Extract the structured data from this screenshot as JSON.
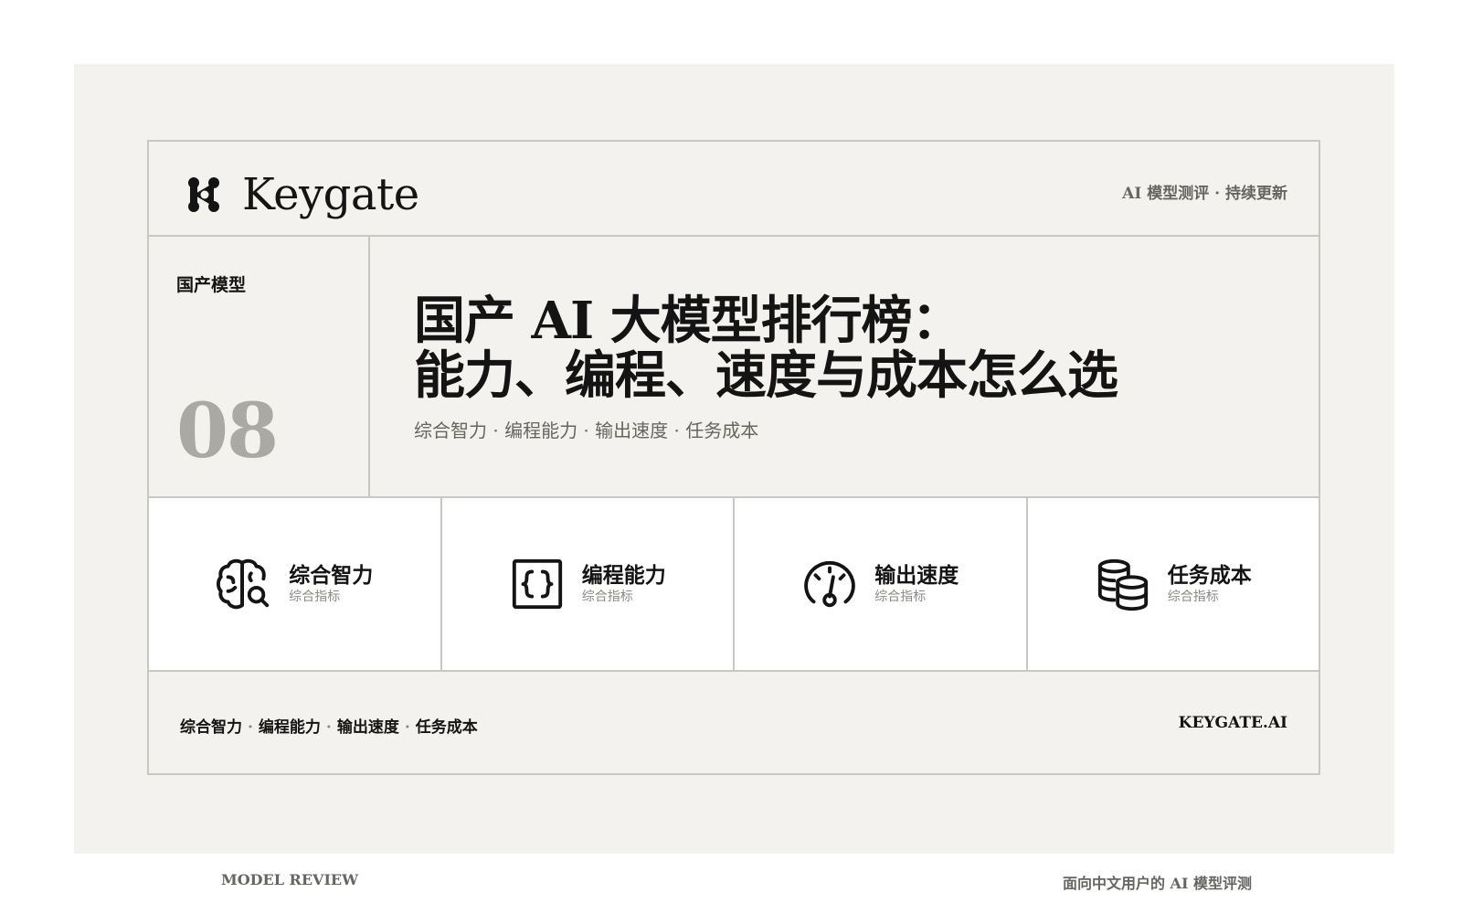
{
  "brand": {
    "name": "Keygate",
    "tagline": "AI 模型测评 · 持续更新"
  },
  "hero": {
    "category": "国产模型",
    "issue_number": "08",
    "title_line1": "国产 AI 大模型排行榜：",
    "title_line2": "能力、编程、速度与成本怎么选",
    "subtitle": "综合智力 · 编程能力 · 输出速度 · 任务成本"
  },
  "features": [
    {
      "icon": "brain-search-icon",
      "title": "综合智力",
      "subtitle": "综合指标"
    },
    {
      "icon": "code-braces-icon",
      "title": "编程能力",
      "subtitle": "综合指标"
    },
    {
      "icon": "speedometer-icon",
      "title": "输出速度",
      "subtitle": "综合指标"
    },
    {
      "icon": "coins-stack-icon",
      "title": "任务成本",
      "subtitle": "综合指标"
    }
  ],
  "footer": {
    "keywords": [
      "综合智力",
      "编程能力",
      "输出速度",
      "任务成本"
    ],
    "separator": "·",
    "site": "KEYGATE.AI"
  },
  "bottom": {
    "left": "MODEL REVIEW",
    "right": "面向中文用户的 AI 模型评测"
  },
  "colors": {
    "background": "#f3f2ef",
    "border": "#c8c7c2",
    "text": "#141414",
    "muted": "#666560",
    "issue": "#aba9a3"
  }
}
